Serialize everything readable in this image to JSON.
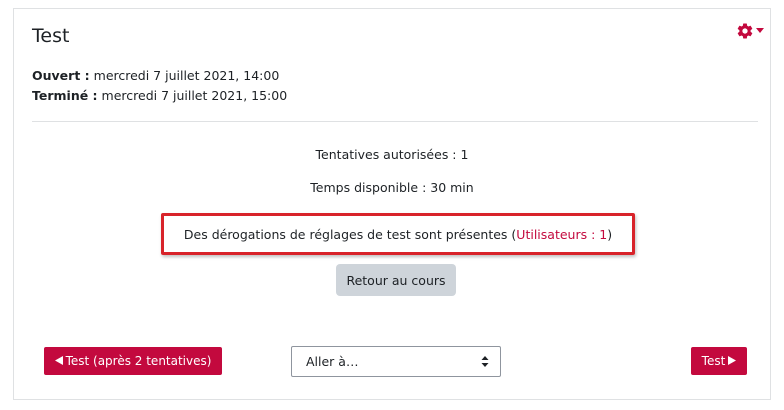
{
  "header": {
    "title": "Test"
  },
  "settings_menu": {
    "icon": "gear-icon",
    "caret_icon": "caret-down-icon",
    "color": "#c3093e"
  },
  "dates": {
    "opened_label": "Ouvert :",
    "opened_value": "mercredi 7 juillet 2021, 14:00",
    "closed_label": "Terminé :",
    "closed_value": "mercredi 7 juillet 2021, 15:00"
  },
  "quiz_info": {
    "attempts_allowed": "Tentatives autorisées : 1",
    "time_limit": "Temps disponible : 30 min"
  },
  "overrides": {
    "text_before": "Des dérogations de réglages de test sont présentes (",
    "link_text": "Utilisateurs : 1",
    "text_after": ")",
    "highlight_color": "#d8232a"
  },
  "actions": {
    "back_to_course": "Retour au cours"
  },
  "navigation": {
    "prev_label": "Test (après 2 tentatives)",
    "prev_icon": "left-triangle-icon",
    "jump_placeholder": "Aller à…",
    "jump_icon": "updown-arrows-icon",
    "next_label": "Test",
    "next_icon": "right-triangle-icon",
    "accent_color": "#c3093e"
  }
}
